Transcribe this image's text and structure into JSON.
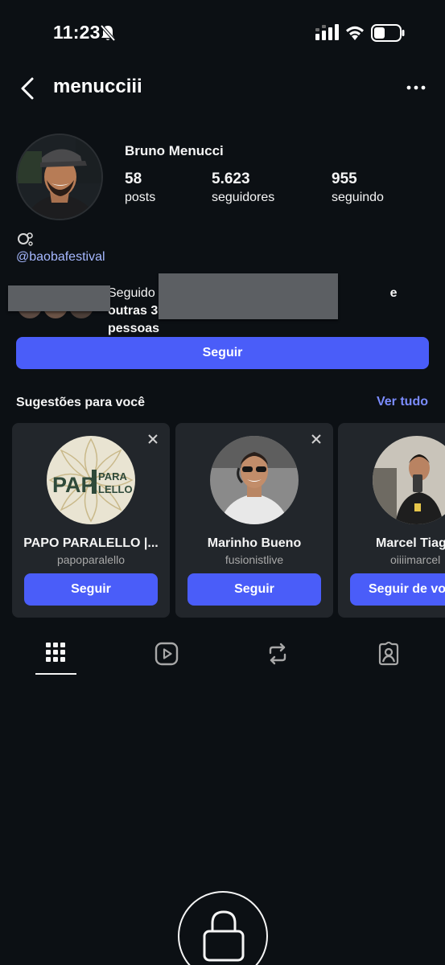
{
  "status_bar": {
    "time": "11:23",
    "icons": [
      "bell-off-icon",
      "signal-icon",
      "wifi-icon",
      "battery-icon"
    ]
  },
  "header": {
    "username": "menucciii",
    "back_icon": "chevron-left-icon",
    "more_icon": "more-horizontal-icon"
  },
  "profile": {
    "full_name": "Bruno Menucci",
    "stats": [
      {
        "value": "58",
        "label": "posts"
      },
      {
        "value": "5.623",
        "label": "seguidores"
      },
      {
        "value": "955",
        "label": "seguindo"
      }
    ],
    "bio_link": "@baobafestival",
    "followed_by": {
      "prefix": "Seguido",
      "suffix": "e outras 30",
      "suffix_line2": "pessoas"
    },
    "follow_label": "Seguir"
  },
  "suggestions": {
    "title": "Sugestões para você",
    "see_all": "Ver tudo",
    "cards": [
      {
        "name": "PAPO PARALELLO |...",
        "handle": "papoparalello",
        "button": "Seguir"
      },
      {
        "name": "Marinho Bueno",
        "handle": "fusionistlive",
        "button": "Seguir"
      },
      {
        "name": "Marcel Tiag",
        "handle": "oiiiimarcel",
        "button": "Seguir de vo"
      }
    ],
    "logo_text": {
      "left": "PAP",
      "right_top": "PARA",
      "right_bottom": "LELLO"
    }
  },
  "tabs": [
    {
      "icon": "grid-icon",
      "active": true
    },
    {
      "icon": "reels-icon",
      "active": false
    },
    {
      "icon": "repost-icon",
      "active": false
    },
    {
      "icon": "tagged-icon",
      "active": false
    }
  ],
  "colors": {
    "background": "#0c1014",
    "accent": "#4a5df9",
    "link": "#a6b8ff",
    "card": "#22262b"
  }
}
